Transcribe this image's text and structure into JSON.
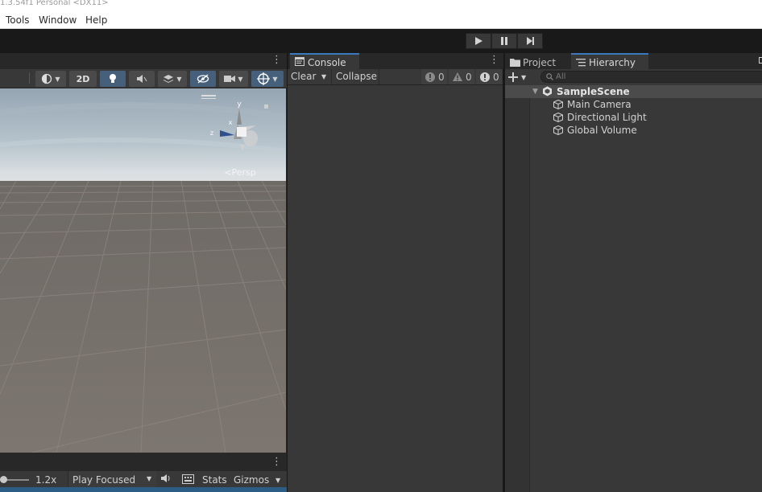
{
  "window": {
    "title": "1.3.54f1 Personal <DX11>"
  },
  "menu": {
    "items": [
      "Tools",
      "Window",
      "Help"
    ]
  },
  "scene_toolbar": {
    "mode_2d": "2D"
  },
  "game_toolbar": {
    "scale_value": "1.2x",
    "play_mode": "Play Focused",
    "stats": "Stats",
    "gizmos": "Gizmos"
  },
  "console": {
    "tab_label": "Console",
    "clear_label": "Clear",
    "collapse_label": "Collapse",
    "log_count": "0",
    "warning_count": "0",
    "error_count": "0"
  },
  "right_tabs": {
    "project_label": "Project",
    "hierarchy_label": "Hierarchy"
  },
  "hierarchy": {
    "search_placeholder": "All",
    "scene_name": "SampleScene",
    "items": [
      "Main Camera",
      "Directional Light",
      "Global Volume"
    ]
  },
  "gizmo": {
    "y_label": "y",
    "x_label": "x",
    "z_label": "z",
    "persp_label": "<Persp"
  },
  "colors": {
    "accent": "#3a79bb",
    "panel": "#383838",
    "dark": "#282828",
    "toggle_on": "#46607c"
  }
}
